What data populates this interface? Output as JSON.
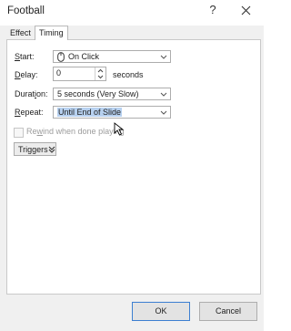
{
  "window": {
    "title": "Football",
    "help_label": "?"
  },
  "tabs": [
    {
      "label": "Effect"
    },
    {
      "label": "Timing"
    }
  ],
  "timing": {
    "start": {
      "label_ul": "S",
      "label_rest": "tart:",
      "value": "On Click",
      "icon": "mouse-icon"
    },
    "delay": {
      "label_ul": "D",
      "label_rest": "elay:",
      "value": "0",
      "unit": "seconds"
    },
    "duration": {
      "label_pre": "Durat",
      "label_ul": "i",
      "label_rest": "on:",
      "value": "5 seconds (Very Slow)"
    },
    "repeat": {
      "label_ul": "R",
      "label_rest": "epeat:",
      "value": "Until End of Slide"
    },
    "rewind": {
      "label_pre": "Re",
      "label_ul": "w",
      "label_rest": "ind when done playing",
      "checked": false,
      "enabled": false
    },
    "triggers": {
      "label": "Triggers"
    }
  },
  "buttons": {
    "ok": "OK",
    "cancel": "Cancel"
  },
  "colors": {
    "selection": "#b7d1f0",
    "ok_border": "#3c7fd1"
  }
}
